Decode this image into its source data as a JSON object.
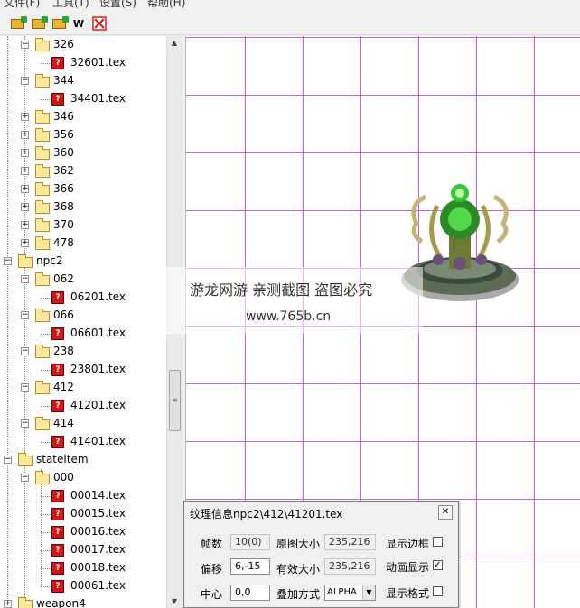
{
  "menu": {
    "file": "文件(F)",
    "tools": "工具(T)",
    "settings": "设置(S)",
    "help": "帮助(H)"
  },
  "toolbar": {
    "w_label": "W"
  },
  "tree": {
    "n326": "326",
    "t32601": "32601.tex",
    "n344": "344",
    "t34401": "34401.tex",
    "n346": "346",
    "n356": "356",
    "n360": "360",
    "n362": "362",
    "n366": "366",
    "n368": "368",
    "n370": "370",
    "n478": "478",
    "npc2": "npc2",
    "n062": "062",
    "t06201": "06201.tex",
    "n066": "066",
    "t06601": "06601.tex",
    "n238": "238",
    "t23801": "23801.tex",
    "n412": "412",
    "t41201": "41201.tex",
    "n414": "414",
    "t41401": "41401.tex",
    "stateitem": "stateitem",
    "n000": "000",
    "t00014": "00014.tex",
    "t00015": "00015.tex",
    "t00016": "00016.tex",
    "t00017": "00017.tex",
    "t00018": "00018.tex",
    "t00061": "00061.tex",
    "weapon4": "weapon4"
  },
  "watermark": {
    "line1": "游龙网游 亲测截图 盗图必究",
    "line2": "www.765b.cn"
  },
  "panel": {
    "title": "纹理信息npc2\\412\\41201.tex",
    "frames_label": "帧数",
    "frames_value": "10(0)",
    "orig_size_label": "原图大小",
    "orig_size_value": "235,216",
    "show_border_label": "显示边框",
    "offset_label": "偏移",
    "offset_value": "6,-15",
    "valid_size_label": "有效大小",
    "valid_size_value": "235,216",
    "anim_label": "动画显示",
    "center_label": "中心",
    "center_value": "0,0",
    "blend_label": "叠加方式",
    "blend_value": "ALPHA",
    "show_format_label": "显示格式",
    "show_border": false,
    "anim_display": true,
    "show_format": false
  },
  "colors": {
    "grid": "#d35cd6",
    "tex_icon": "#d51414",
    "folder": "#fbe99b"
  }
}
